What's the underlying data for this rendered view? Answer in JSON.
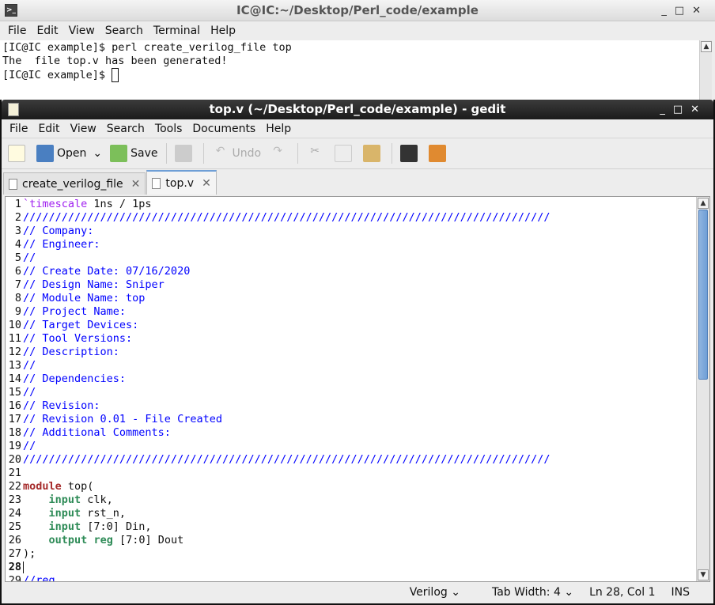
{
  "terminal": {
    "title": "IC@IC:~/Desktop/Perl_code/example",
    "menu": [
      "File",
      "Edit",
      "View",
      "Search",
      "Terminal",
      "Help"
    ],
    "lines": [
      "[IC@IC example]$ perl create_verilog_file top",
      "The  file top.v has been generated!",
      "",
      "[IC@IC example]$ "
    ]
  },
  "gedit": {
    "title": "top.v (~/Desktop/Perl_code/example) - gedit",
    "menu": [
      "File",
      "Edit",
      "View",
      "Search",
      "Tools",
      "Documents",
      "Help"
    ],
    "toolbar": {
      "open": "Open",
      "save": "Save",
      "undo": "Undo"
    },
    "tabs": [
      {
        "label": "create_verilog_file"
      },
      {
        "label": "top.v",
        "active": true
      }
    ],
    "code": [
      [
        {
          "t": "`timescale",
          "c": "pp"
        },
        {
          "t": " 1ns / 1ps",
          "c": "pl"
        }
      ],
      [
        {
          "t": "//////////////////////////////////////////////////////////////////////////////////",
          "c": "cm"
        }
      ],
      [
        {
          "t": "// Company: ",
          "c": "cm"
        }
      ],
      [
        {
          "t": "// Engineer: ",
          "c": "cm"
        }
      ],
      [
        {
          "t": "// ",
          "c": "cm"
        }
      ],
      [
        {
          "t": "// Create Date: 07/16/2020",
          "c": "cm"
        }
      ],
      [
        {
          "t": "// Design Name: Sniper",
          "c": "cm"
        }
      ],
      [
        {
          "t": "// Module Name: top",
          "c": "cm"
        }
      ],
      [
        {
          "t": "// Project Name: ",
          "c": "cm"
        }
      ],
      [
        {
          "t": "// Target Devices: ",
          "c": "cm"
        }
      ],
      [
        {
          "t": "// Tool Versions: ",
          "c": "cm"
        }
      ],
      [
        {
          "t": "// Description: ",
          "c": "cm"
        }
      ],
      [
        {
          "t": "// ",
          "c": "cm"
        }
      ],
      [
        {
          "t": "// Dependencies: ",
          "c": "cm"
        }
      ],
      [
        {
          "t": "// ",
          "c": "cm"
        }
      ],
      [
        {
          "t": "// Revision:",
          "c": "cm"
        }
      ],
      [
        {
          "t": "// Revision 0.01 - File Created",
          "c": "cm"
        }
      ],
      [
        {
          "t": "// Additional Comments:",
          "c": "cm"
        }
      ],
      [
        {
          "t": "// ",
          "c": "cm"
        }
      ],
      [
        {
          "t": "//////////////////////////////////////////////////////////////////////////////////",
          "c": "cm"
        }
      ],
      [],
      [
        {
          "t": "module",
          "c": "kw"
        },
        {
          "t": " top(",
          "c": "pl"
        }
      ],
      [
        {
          "t": "    ",
          "c": "pl"
        },
        {
          "t": "input",
          "c": "ty"
        },
        {
          "t": " clk,",
          "c": "pl"
        }
      ],
      [
        {
          "t": "    ",
          "c": "pl"
        },
        {
          "t": "input",
          "c": "ty"
        },
        {
          "t": " rst_n,",
          "c": "pl"
        }
      ],
      [
        {
          "t": "    ",
          "c": "pl"
        },
        {
          "t": "input",
          "c": "ty"
        },
        {
          "t": " [7:0] Din,",
          "c": "pl"
        }
      ],
      [
        {
          "t": "    ",
          "c": "pl"
        },
        {
          "t": "output",
          "c": "ty"
        },
        {
          "t": " ",
          "c": "pl"
        },
        {
          "t": "reg",
          "c": "ty"
        },
        {
          "t": " [7:0] Dout",
          "c": "pl"
        }
      ],
      [
        {
          "t": ");",
          "c": "pl"
        }
      ],
      [],
      [
        {
          "t": "//reg",
          "c": "cm"
        }
      ]
    ],
    "current_line": 28,
    "status": {
      "language": "Verilog",
      "tab_width": "Tab Width: 4",
      "position": "Ln 28, Col 1",
      "mode": "INS"
    },
    "scroll_position": 0.05
  }
}
